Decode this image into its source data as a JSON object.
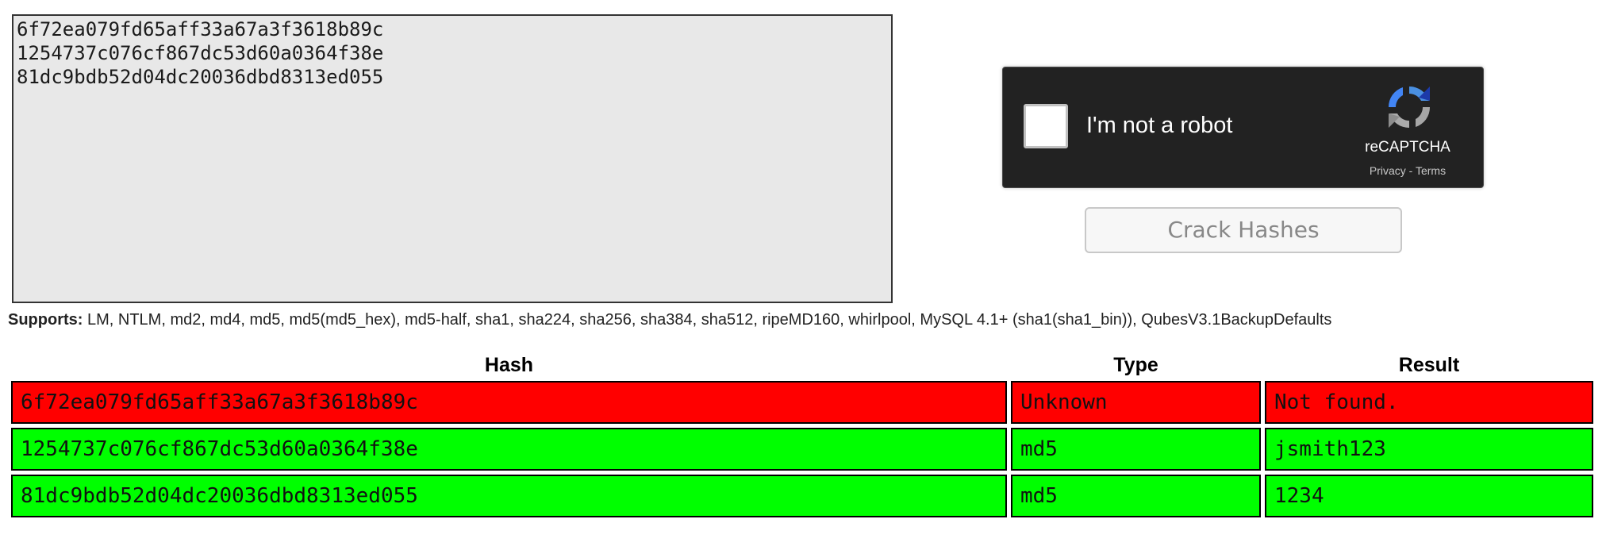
{
  "hash_input": {
    "lines": [
      "6f72ea079fd65aff33a67a3f3618b89c",
      "1254737c076cf867dc53d60a0364f38e",
      "81dc9bdb52d04dc20036dbd8313ed055"
    ]
  },
  "recaptcha": {
    "label": "I'm not a robot",
    "brand": "reCAPTCHA",
    "privacy_link": "Privacy",
    "separator": " - ",
    "terms_link": "Terms"
  },
  "crack_button": {
    "label": "Crack Hashes"
  },
  "supports": {
    "label": "Supports:",
    "text": " LM, NTLM, md2, md4, md5, md5(md5_hex), md5-half, sha1, sha224, sha256, sha384, sha512, ripeMD160, whirlpool, MySQL 4.1+ (sha1(sha1_bin)), QubesV3.1BackupDefaults"
  },
  "results": {
    "headers": {
      "hash": "Hash",
      "type": "Type",
      "result": "Result"
    },
    "rows": [
      {
        "hash": "6f72ea079fd65aff33a67a3f3618b89c",
        "type": "Unknown",
        "result": "Not found.",
        "status": "not-found",
        "color": "#ff0000"
      },
      {
        "hash": "1254737c076cf867dc53d60a0364f38e",
        "type": "md5",
        "result": "jsmith123",
        "status": "found",
        "color": "#00ff00"
      },
      {
        "hash": "81dc9bdb52d04dc20036dbd8313ed055",
        "type": "md5",
        "result": "1234",
        "status": "found",
        "color": "#00ff00"
      }
    ]
  },
  "colors": {
    "not_found": "#ff0000",
    "found": "#00ff00",
    "textarea_bg": "#e8e8e8",
    "recaptcha_bg": "#222222"
  },
  "icons": {
    "recaptcha_logo": "recaptcha-logo-icon"
  }
}
